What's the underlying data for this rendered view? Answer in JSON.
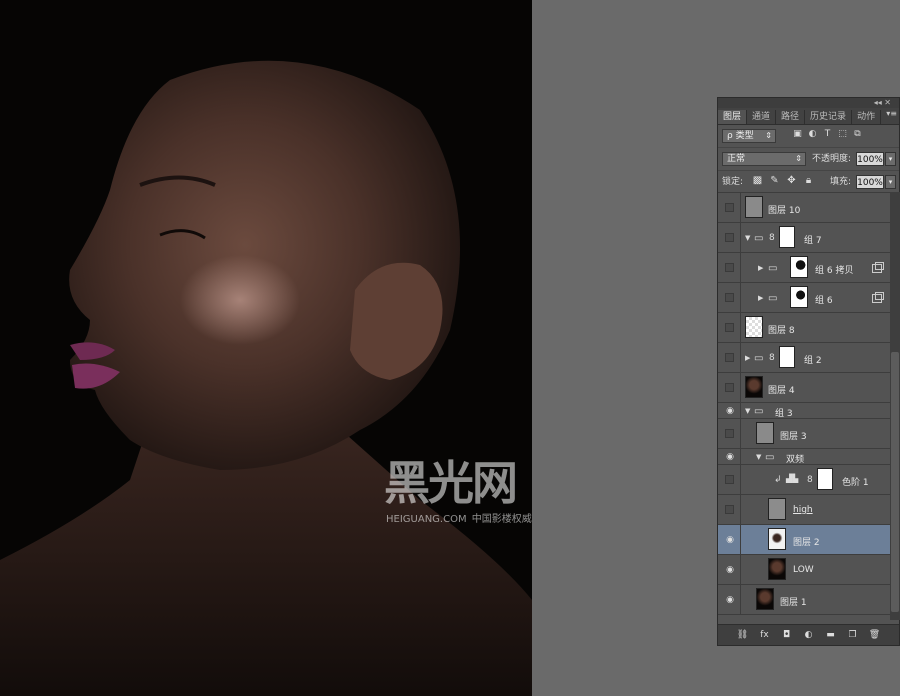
{
  "watermark": {
    "logo": "黑光网",
    "domain": "HEIGUANG.COM",
    "tagline": "中国影楼权威门户"
  },
  "panel": {
    "tabs": [
      {
        "label": "图层",
        "active": true
      },
      {
        "label": "通道",
        "active": false
      },
      {
        "label": "路径",
        "active": false
      },
      {
        "label": "历史记录",
        "active": false
      },
      {
        "label": "动作",
        "active": false
      }
    ],
    "filter_kind": "ρ 类型",
    "blend_mode": "正常",
    "opacity_label": "不透明度:",
    "opacity_value": "100%",
    "lock_label": "锁定:",
    "fill_label": "填充:",
    "fill_value": "100%",
    "layers": [
      {
        "name": "图层 10",
        "visible": false,
        "kind": "pixel"
      },
      {
        "name": "组 7",
        "visible": false,
        "kind": "group",
        "expanded": true
      },
      {
        "name": "组 6 拷贝",
        "visible": false,
        "kind": "group",
        "expanded": false
      },
      {
        "name": "组 6",
        "visible": false,
        "kind": "group",
        "expanded": false
      },
      {
        "name": "图层 8",
        "visible": false,
        "kind": "pixel"
      },
      {
        "name": "组 2",
        "visible": false,
        "kind": "group",
        "expanded": false
      },
      {
        "name": "图层 4",
        "visible": false,
        "kind": "pixel"
      },
      {
        "name": "组 3",
        "visible": true,
        "kind": "group",
        "expanded": true
      },
      {
        "name": "图层 3",
        "visible": false,
        "kind": "pixel"
      },
      {
        "name": "双频",
        "visible": true,
        "kind": "group",
        "expanded": true
      },
      {
        "name": "色阶 1",
        "visible": false,
        "kind": "adjustment"
      },
      {
        "name": "high",
        "visible": false,
        "kind": "pixel"
      },
      {
        "name": "图层 2",
        "visible": true,
        "kind": "pixel",
        "selected": true
      },
      {
        "name": "LOW",
        "visible": true,
        "kind": "pixel"
      },
      {
        "name": "图层 1",
        "visible": true,
        "kind": "pixel"
      }
    ]
  }
}
